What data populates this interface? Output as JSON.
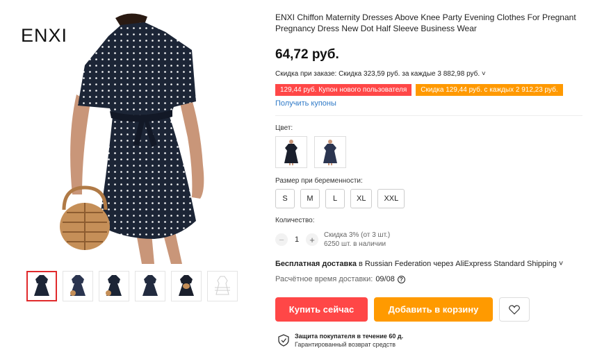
{
  "brand": "ENXI",
  "product": {
    "title": "ENXI Chiffon Maternity Dresses Above Knee Party Evening Clothes For Pregnant Pregnancy Dress New Dot Half Sleeve Business Wear",
    "price": "64,72 руб.",
    "discount_text": "Скидка при заказе: Скидка 323,59 руб. за каждые 3 882,98 руб. ˅",
    "coupons": [
      {
        "text": "129,44 руб. Купон нового пользователя",
        "color": "#ff4747"
      },
      {
        "text": "Скидка 129,44 руб. с каждых 2 912,23 руб.",
        "color": "#ff9900"
      }
    ],
    "get_coupons": "Получить купоны"
  },
  "color": {
    "label": "Цвет:",
    "options": [
      {
        "icon": "dress-dark-thumb"
      },
      {
        "icon": "dress-navy-thumb"
      }
    ]
  },
  "size": {
    "label": "Размер при беременности:",
    "options": [
      "S",
      "M",
      "L",
      "XL",
      "XXL"
    ]
  },
  "quantity": {
    "label": "Количество:",
    "value": "1",
    "minus": "−",
    "plus": "+",
    "discount": "Скидка 3% (от 3 шт.)",
    "stock": "6250 шт. в наличии"
  },
  "shipping": {
    "bold": "Бесплатная доставка",
    "rest": " в Russian Federation через AliExpress Standard Shipping ˅",
    "delivery_label": "Расчётное время доставки:",
    "delivery_value": "09/08",
    "help_glyph": "?"
  },
  "actions": {
    "buy": "Купить сейчас",
    "cart": "Добавить в корзину"
  },
  "protection": {
    "title": "Защита покупателя в течение 60 д.",
    "subtitle": "Гарантированный возврат средств"
  },
  "colors": {
    "accent_red": "#ff4747",
    "accent_orange": "#ff9a00",
    "link": "#2e79c7",
    "dress": "#1c2536"
  }
}
